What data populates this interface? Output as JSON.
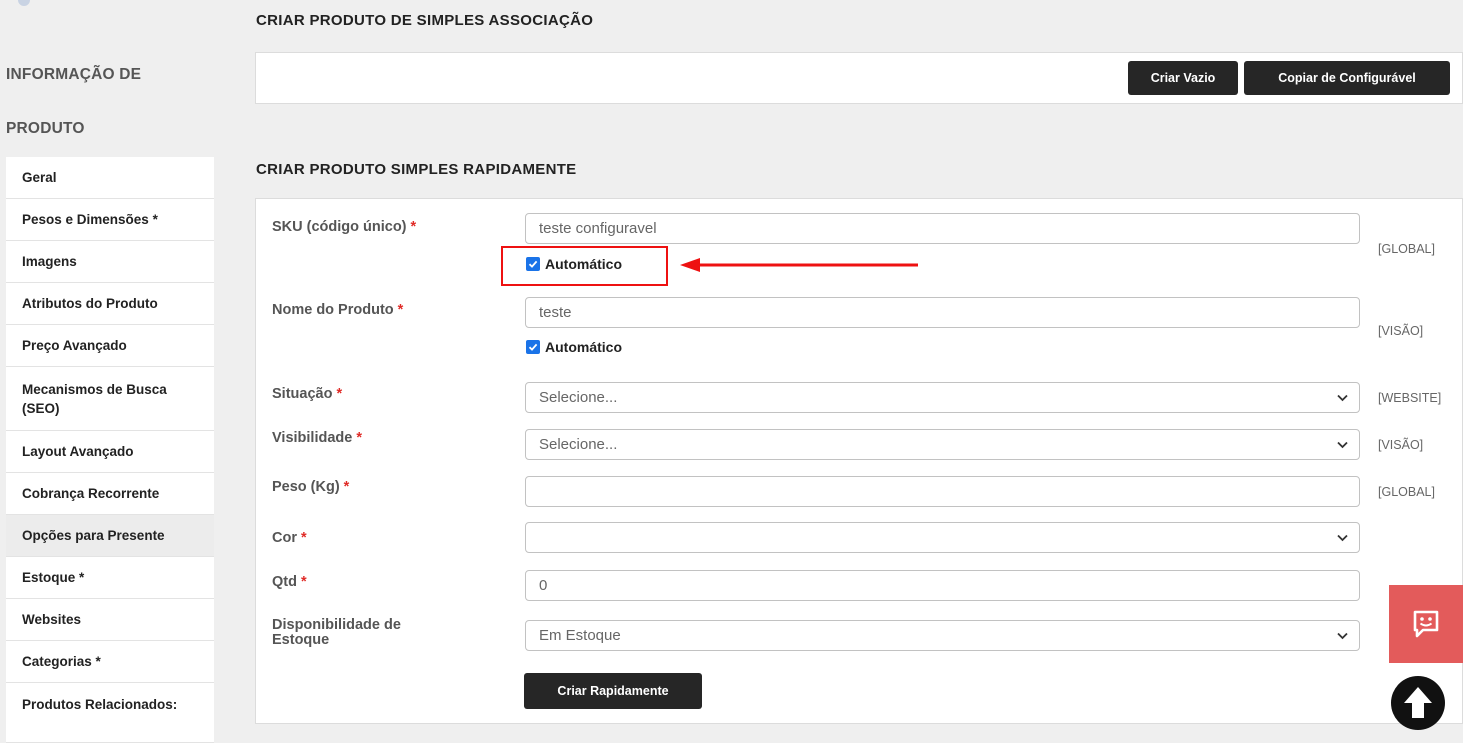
{
  "sidebar": {
    "title_line1": "INFORMAÇÃO DE",
    "title_line2": "PRODUTO",
    "items": [
      {
        "label": "Geral"
      },
      {
        "label": "Pesos e Dimensões *"
      },
      {
        "label": "Imagens"
      },
      {
        "label": "Atributos do Produto"
      },
      {
        "label": "Preço Avançado"
      },
      {
        "label": "Mecanismos de Busca (SEO)"
      },
      {
        "label": "Layout Avançado"
      },
      {
        "label": "Cobrança Recorrente"
      },
      {
        "label": "Opções para Presente"
      },
      {
        "label": "Estoque *"
      },
      {
        "label": "Websites"
      },
      {
        "label": "Categorias *"
      },
      {
        "label": "Produtos Relacionados:"
      }
    ]
  },
  "association": {
    "title": "CRIAR PRODUTO DE SIMPLES ASSOCIAÇÃO",
    "btn_empty": "Criar Vazio",
    "btn_copy": "Copiar de Configurável"
  },
  "quick": {
    "title": "CRIAR PRODUTO SIMPLES RAPIDAMENTE",
    "required_mark": "*",
    "sku": {
      "label": "SKU (código único)",
      "value": "teste configuravel",
      "auto_label": "Automático",
      "scope": "[GLOBAL]"
    },
    "name": {
      "label": "Nome do Produto",
      "value": "teste",
      "auto_label": "Automático",
      "scope": "[VISÃO]"
    },
    "status": {
      "label": "Situação",
      "value": "Selecione...",
      "scope": "[WEBSITE]"
    },
    "visibility": {
      "label": "Visibilidade",
      "value": "Selecione...",
      "scope": "[VISÃO]"
    },
    "weight": {
      "label": "Peso (Kg)",
      "value": "",
      "scope": "[GLOBAL]"
    },
    "color": {
      "label": "Cor",
      "value": ""
    },
    "qty": {
      "label": "Qtd",
      "value": "0"
    },
    "stock": {
      "label_line1": "Disponibilidade de",
      "label_line2": "Estoque",
      "value": "Em Estoque"
    },
    "submit_label": "Criar Rapidamente"
  },
  "colors": {
    "highlight": "#ee1111",
    "chat": "#e35b5b",
    "checkbox": "#1a73e8"
  }
}
